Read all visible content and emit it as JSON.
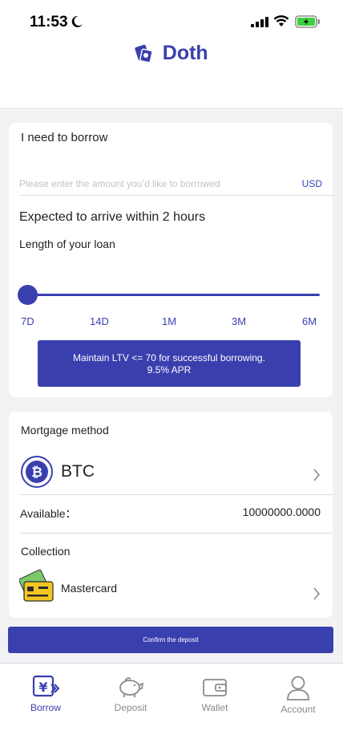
{
  "status_bar": {
    "time": "11:53"
  },
  "header": {
    "brand": "Doth"
  },
  "borrow": {
    "title": "I need to borrow",
    "amount_placeholder": "Please enter the amount you’d like to borrowed",
    "currency": "USD",
    "arrive_text": "Expected to arrive within 2 hours",
    "loan_length_label": "Length of your loan",
    "loan_terms": [
      "7D",
      "14D",
      "1M",
      "3M",
      "6M"
    ],
    "selected_term": "7D",
    "ltv_line1": "Maintain LTV <= 70 for successful borrowing.",
    "ltv_line2": "9.5% APR"
  },
  "mortgage": {
    "title": "Mortgage method",
    "asset": "BTC",
    "available_label": "Available：",
    "available_value": "10000000.0000",
    "collection_label": "Collection",
    "collection_method": "Mastercard"
  },
  "confirm_label": "Confirm the deposit",
  "nav": {
    "borrow": "Borrow",
    "deposit": "Deposit",
    "wallet": "Wallet",
    "account": "Account",
    "active": "Borrow"
  },
  "colors": {
    "accent": "#3a3fae",
    "background": "#f2f2f5",
    "battery": "#3ecf3e"
  }
}
